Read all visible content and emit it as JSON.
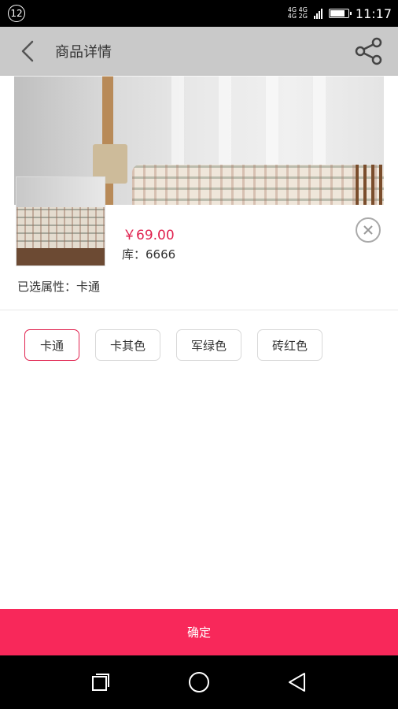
{
  "status_bar": {
    "notification_count": "12",
    "network_top": "4G 4G",
    "network_bottom": "4G 2G",
    "time": "11:17",
    "battery_level": 0.75
  },
  "header": {
    "title": "商品详情",
    "back_icon": "chevron-left-icon",
    "share_icon": "share-icon"
  },
  "product": {
    "price": "￥69.00",
    "stock": "库：6666",
    "selected_attribute": "已选属性：卡通",
    "close_icon": "close-circle-icon"
  },
  "options": [
    {
      "label": "卡通",
      "selected": true
    },
    {
      "label": "卡其色",
      "selected": false
    },
    {
      "label": "军绿色",
      "selected": false
    },
    {
      "label": "砖红色",
      "selected": false
    }
  ],
  "confirm_label": "确定",
  "colors": {
    "accent": "#f8285a",
    "price": "#e0224f",
    "header_overlay": "#c9c9c9"
  },
  "nav": {
    "recents_icon": "recents-square-icon",
    "home_icon": "home-circle-icon",
    "back_icon": "back-triangle-icon"
  }
}
